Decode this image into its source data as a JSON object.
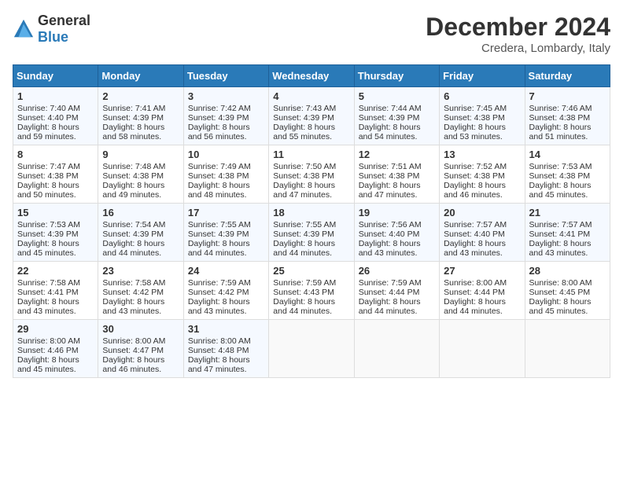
{
  "logo": {
    "general": "General",
    "blue": "Blue"
  },
  "title": "December 2024",
  "location": "Credera, Lombardy, Italy",
  "weekdays": [
    "Sunday",
    "Monday",
    "Tuesday",
    "Wednesday",
    "Thursday",
    "Friday",
    "Saturday"
  ],
  "weeks": [
    [
      {
        "day": "1",
        "lines": [
          "Sunrise: 7:40 AM",
          "Sunset: 4:40 PM",
          "Daylight: 8 hours",
          "and 59 minutes."
        ]
      },
      {
        "day": "2",
        "lines": [
          "Sunrise: 7:41 AM",
          "Sunset: 4:39 PM",
          "Daylight: 8 hours",
          "and 58 minutes."
        ]
      },
      {
        "day": "3",
        "lines": [
          "Sunrise: 7:42 AM",
          "Sunset: 4:39 PM",
          "Daylight: 8 hours",
          "and 56 minutes."
        ]
      },
      {
        "day": "4",
        "lines": [
          "Sunrise: 7:43 AM",
          "Sunset: 4:39 PM",
          "Daylight: 8 hours",
          "and 55 minutes."
        ]
      },
      {
        "day": "5",
        "lines": [
          "Sunrise: 7:44 AM",
          "Sunset: 4:39 PM",
          "Daylight: 8 hours",
          "and 54 minutes."
        ]
      },
      {
        "day": "6",
        "lines": [
          "Sunrise: 7:45 AM",
          "Sunset: 4:38 PM",
          "Daylight: 8 hours",
          "and 53 minutes."
        ]
      },
      {
        "day": "7",
        "lines": [
          "Sunrise: 7:46 AM",
          "Sunset: 4:38 PM",
          "Daylight: 8 hours",
          "and 51 minutes."
        ]
      }
    ],
    [
      {
        "day": "8",
        "lines": [
          "Sunrise: 7:47 AM",
          "Sunset: 4:38 PM",
          "Daylight: 8 hours",
          "and 50 minutes."
        ]
      },
      {
        "day": "9",
        "lines": [
          "Sunrise: 7:48 AM",
          "Sunset: 4:38 PM",
          "Daylight: 8 hours",
          "and 49 minutes."
        ]
      },
      {
        "day": "10",
        "lines": [
          "Sunrise: 7:49 AM",
          "Sunset: 4:38 PM",
          "Daylight: 8 hours",
          "and 48 minutes."
        ]
      },
      {
        "day": "11",
        "lines": [
          "Sunrise: 7:50 AM",
          "Sunset: 4:38 PM",
          "Daylight: 8 hours",
          "and 47 minutes."
        ]
      },
      {
        "day": "12",
        "lines": [
          "Sunrise: 7:51 AM",
          "Sunset: 4:38 PM",
          "Daylight: 8 hours",
          "and 47 minutes."
        ]
      },
      {
        "day": "13",
        "lines": [
          "Sunrise: 7:52 AM",
          "Sunset: 4:38 PM",
          "Daylight: 8 hours",
          "and 46 minutes."
        ]
      },
      {
        "day": "14",
        "lines": [
          "Sunrise: 7:53 AM",
          "Sunset: 4:38 PM",
          "Daylight: 8 hours",
          "and 45 minutes."
        ]
      }
    ],
    [
      {
        "day": "15",
        "lines": [
          "Sunrise: 7:53 AM",
          "Sunset: 4:39 PM",
          "Daylight: 8 hours",
          "and 45 minutes."
        ]
      },
      {
        "day": "16",
        "lines": [
          "Sunrise: 7:54 AM",
          "Sunset: 4:39 PM",
          "Daylight: 8 hours",
          "and 44 minutes."
        ]
      },
      {
        "day": "17",
        "lines": [
          "Sunrise: 7:55 AM",
          "Sunset: 4:39 PM",
          "Daylight: 8 hours",
          "and 44 minutes."
        ]
      },
      {
        "day": "18",
        "lines": [
          "Sunrise: 7:55 AM",
          "Sunset: 4:39 PM",
          "Daylight: 8 hours",
          "and 44 minutes."
        ]
      },
      {
        "day": "19",
        "lines": [
          "Sunrise: 7:56 AM",
          "Sunset: 4:40 PM",
          "Daylight: 8 hours",
          "and 43 minutes."
        ]
      },
      {
        "day": "20",
        "lines": [
          "Sunrise: 7:57 AM",
          "Sunset: 4:40 PM",
          "Daylight: 8 hours",
          "and 43 minutes."
        ]
      },
      {
        "day": "21",
        "lines": [
          "Sunrise: 7:57 AM",
          "Sunset: 4:41 PM",
          "Daylight: 8 hours",
          "and 43 minutes."
        ]
      }
    ],
    [
      {
        "day": "22",
        "lines": [
          "Sunrise: 7:58 AM",
          "Sunset: 4:41 PM",
          "Daylight: 8 hours",
          "and 43 minutes."
        ]
      },
      {
        "day": "23",
        "lines": [
          "Sunrise: 7:58 AM",
          "Sunset: 4:42 PM",
          "Daylight: 8 hours",
          "and 43 minutes."
        ]
      },
      {
        "day": "24",
        "lines": [
          "Sunrise: 7:59 AM",
          "Sunset: 4:42 PM",
          "Daylight: 8 hours",
          "and 43 minutes."
        ]
      },
      {
        "day": "25",
        "lines": [
          "Sunrise: 7:59 AM",
          "Sunset: 4:43 PM",
          "Daylight: 8 hours",
          "and 44 minutes."
        ]
      },
      {
        "day": "26",
        "lines": [
          "Sunrise: 7:59 AM",
          "Sunset: 4:44 PM",
          "Daylight: 8 hours",
          "and 44 minutes."
        ]
      },
      {
        "day": "27",
        "lines": [
          "Sunrise: 8:00 AM",
          "Sunset: 4:44 PM",
          "Daylight: 8 hours",
          "and 44 minutes."
        ]
      },
      {
        "day": "28",
        "lines": [
          "Sunrise: 8:00 AM",
          "Sunset: 4:45 PM",
          "Daylight: 8 hours",
          "and 45 minutes."
        ]
      }
    ],
    [
      {
        "day": "29",
        "lines": [
          "Sunrise: 8:00 AM",
          "Sunset: 4:46 PM",
          "Daylight: 8 hours",
          "and 45 minutes."
        ]
      },
      {
        "day": "30",
        "lines": [
          "Sunrise: 8:00 AM",
          "Sunset: 4:47 PM",
          "Daylight: 8 hours",
          "and 46 minutes."
        ]
      },
      {
        "day": "31",
        "lines": [
          "Sunrise: 8:00 AM",
          "Sunset: 4:48 PM",
          "Daylight: 8 hours",
          "and 47 minutes."
        ]
      },
      null,
      null,
      null,
      null
    ]
  ]
}
